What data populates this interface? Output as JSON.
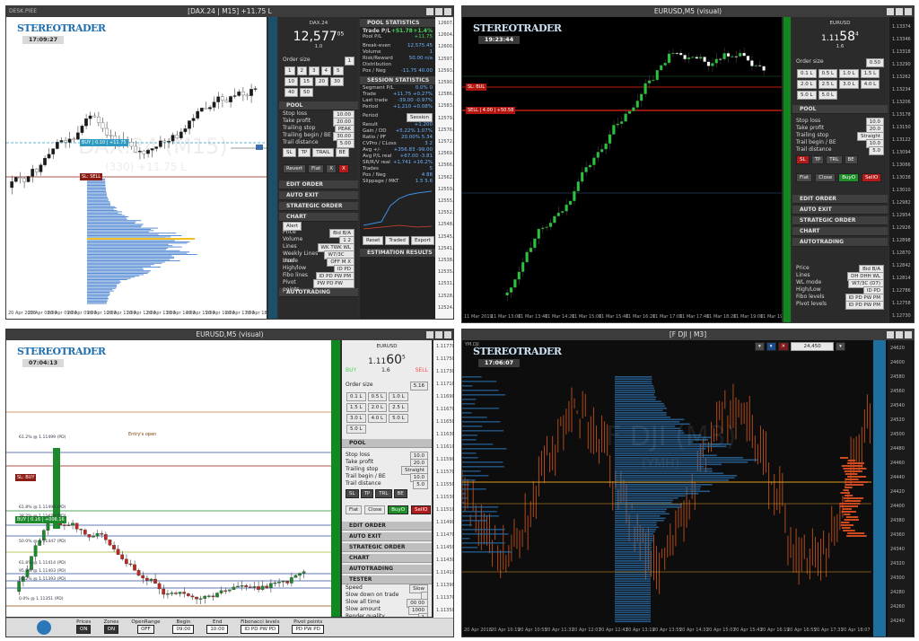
{
  "windows": {
    "w1": {
      "title": "[DAX.24 | M15] +11.75 L",
      "symbol": "DESK.PIEE",
      "brand": "STEREOTRADER",
      "clock": "17:09:27",
      "watermark": "DAX.24 (M15)",
      "watermark_sub": "(330) +11.75 L",
      "y_ticks": [
        "12607.45",
        "12604.00",
        "12600.55",
        "12597.10",
        "12593.65",
        "12590.20",
        "12586.75",
        "12583.30",
        "12579.85",
        "12576.40",
        "12572.95",
        "12569.50",
        "12566.05",
        "12562.60",
        "12559.15",
        "12555.70",
        "12552.25",
        "12548.80",
        "12545.35",
        "12541.90",
        "12538.45",
        "12535.00",
        "12531.55",
        "12528.10",
        "12524.65"
      ],
      "x_ticks": [
        "20 Apr 2018",
        "20 Apr 08:00",
        "20 Apr 09:00",
        "20 Apr 09:00",
        "20 Apr 10:00",
        "20 Apr 11:00",
        "20 Apr 12:00",
        "20 Apr 13:00",
        "20 Apr 14:00",
        "20 Apr 15:00",
        "20 Apr 16:00",
        "20 Apr 17:00",
        "20 Apr 18:00"
      ],
      "line_label_sl": "SL: SELL",
      "line_label_buy": "BUY | 0.10 | +11.75",
      "panel": {
        "symbol": "DAX.24",
        "price": "12,577",
        "price_suffix": "05",
        "spread": "1.0",
        "order_size_label": "Order size",
        "order_size": "1",
        "size_grid": [
          "1",
          "2",
          "3",
          "4",
          "5",
          "10",
          "15",
          "20",
          "30",
          "40",
          "50"
        ],
        "pool": "POOL",
        "fields": [
          {
            "label": "Stop loss",
            "value": "10.00"
          },
          {
            "label": "Take profit",
            "value": "20.00"
          },
          {
            "label": "Trailing stop",
            "value": "PEAK"
          },
          {
            "label": "Trailing begin / BE",
            "value": "30.00"
          },
          {
            "label": "Trail distance",
            "value": "5.00"
          }
        ],
        "mode_btns": [
          "SL",
          "TP",
          "TRAIL",
          "BE"
        ],
        "action_btns": [
          "Revert",
          "Flat",
          "X",
          "X"
        ],
        "action_right": [
          "BUY",
          "8"
        ],
        "sections": [
          "EDIT ORDER",
          "AUTO EXIT",
          "STRATEGIC ORDER",
          "CHART",
          "AUTOTRADING"
        ],
        "chart_rows": [
          {
            "label": "Price",
            "value": "Bid  B/A"
          },
          {
            "label": "Volume",
            "value": "1  2"
          },
          {
            "label": "Lines",
            "value": "WK  TWK  WL"
          },
          {
            "label": "Weekly Lines mode",
            "value": "W7/3C (D7)"
          },
          {
            "label": "User",
            "value": "OFF  M  X"
          },
          {
            "label": "High/low",
            "value": "ID  PD"
          },
          {
            "label": "Fibo lines",
            "value": "ID  PD  PW  PM"
          },
          {
            "label": "Pivot points",
            "value": "PW  PD  PW  PM"
          }
        ],
        "alert_label": "Alert"
      },
      "stats": {
        "pool_title": "POOL STATISTICS",
        "trade_pl": "+51.78",
        "trade_pl_pct": "+1.4%",
        "pool_pl": "+11.75",
        "rows1": [
          {
            "k": "Break-even",
            "v": "12,575.45"
          },
          {
            "k": "Volume",
            "v": "1"
          },
          {
            "k": "Risk/Reward",
            "v": "50.00  n/a"
          },
          {
            "k": "Distribution",
            "v": ""
          },
          {
            "k": "Pos / Neg",
            "v": "-11.75  40.00"
          }
        ],
        "session_title": "SESSION STATISTICS",
        "rows2": [
          {
            "k": "Segment P/L",
            "v": "0.0%  0"
          },
          {
            "k": "Trade",
            "v": "+11.75  +0.27%"
          },
          {
            "k": "Last trade",
            "v": "-39.00  -0.97%"
          },
          {
            "k": "Period",
            "v": "+1,210  +0.08%"
          }
        ],
        "period_label": "Period",
        "period_value": "Session",
        "rows3": [
          {
            "k": "Result",
            "v": "+1,200"
          },
          {
            "k": "Gain / DD",
            "v": "+5.22%  1.07%"
          },
          {
            "k": "Ratio / PF",
            "v": "20.00%  5.34"
          },
          {
            "k": "CVPro / CLoss",
            "v": "3  2"
          },
          {
            "k": "Avg +/-",
            "v": "+356.83  -99.00"
          },
          {
            "k": "Avg P/L real",
            "v": "+67.00  -3.81"
          },
          {
            "k": "SR/R/V real",
            "v": "+1,741  +16.2%"
          },
          {
            "k": "Trades",
            "v": "5"
          },
          {
            "k": "Pos / Neg",
            "v": "4  88"
          },
          {
            "k": "Slippage / MKT",
            "v": "1.5  5.6"
          }
        ],
        "btns": [
          "Reset",
          "Traded",
          "Export"
        ],
        "estimation": "ESTIMATION RESULTS"
      }
    },
    "w2": {
      "title": "EURUSD,M5 (visual)",
      "brand": "STEREOTRADER",
      "clock": "19:23:44",
      "sl_label": "SL: BUL",
      "sell_label": "SELL | 4.00 | +50.58",
      "y_ticks": [
        "1.13374",
        "1.13346",
        "1.13318",
        "1.13290",
        "1.13262",
        "1.13234",
        "1.13206",
        "1.13178",
        "1.13150",
        "1.13122",
        "1.13094",
        "1.13066",
        "1.13038",
        "1.13010",
        "1.12982",
        "1.12954",
        "1.12926",
        "1.12898",
        "1.12870",
        "1.12842",
        "1.12814",
        "1.12786",
        "1.12758",
        "1.12730"
      ],
      "x_ticks": [
        "11 Mar 2019",
        "11 Mar 13:00",
        "11 Mar 13:40",
        "11 Mar 14:20",
        "11 Mar 15:00",
        "11 Mar 15:40",
        "11 Mar 16:20",
        "11 Mar 17:00",
        "11 Mar 17:40",
        "11 Mar 18:20",
        "11 Mar 19:00",
        "11 Mar 19:40"
      ],
      "panel": {
        "symbol": "EURUSD",
        "price_main": "1.11",
        "price_big": "58",
        "price_suffix": "4",
        "spread": "1.6",
        "order_size_label": "Order size",
        "order_size": "0.50",
        "lots": [
          "0.1 L",
          "0.5 L",
          "1.0 L",
          "1.5 L",
          "2.0 L",
          "2.5 L",
          "3.0 L",
          "4.0 L",
          "5.0 L",
          "5.0 L"
        ],
        "pool": "POOL",
        "fields": [
          {
            "label": "Stop loss",
            "value": "10.0"
          },
          {
            "label": "Take profit",
            "value": "20.0"
          },
          {
            "label": "Trailing stop",
            "value": "Straight"
          },
          {
            "label": "Trail begin / BE",
            "value": "10.0"
          },
          {
            "label": "Trail distance",
            "value": "5.0"
          }
        ],
        "mode_btns": [
          "SL",
          "TP",
          "TRL",
          "BE"
        ],
        "actions": [
          "Flat",
          "Close",
          "BuyO",
          "SellO"
        ],
        "sections": [
          "EDIT ORDER",
          "AUTO EXIT",
          "STRATEGIC ORDER",
          "CHART",
          "AUTOTRADING"
        ],
        "chart_rows": [
          {
            "label": "Price",
            "value": "Bid  B/A"
          },
          {
            "label": "Lines",
            "value": "DH  DHH  WL"
          },
          {
            "label": "WL mode",
            "value": "W7/3C (D7)"
          },
          {
            "label": "High/Low",
            "value": "ID  PD"
          },
          {
            "label": "Fibo levels",
            "value": "ID  PD  PW  PM"
          },
          {
            "label": "Pivot levels",
            "value": "ID  PD  PW  PM"
          }
        ]
      }
    },
    "w3": {
      "title": "EURUSD,M5 (visual)",
      "brand": "STEREOTRADER",
      "clock": "07:04:13",
      "sl_label": "SL: BUY",
      "buy_label": "BUY | 0.16 | +006.16",
      "upper_label": "Entry's open",
      "fib_labels": [
        "61.2% @ 1.11499 (PD)",
        "61.8% @ 1.11490 (PD)",
        "38.2% @ 1.11470 (PD)",
        "50.0% @ 1.11447 (PD)",
        "61.8% @ 1.11414 (PD)",
        "95.5% @ 1.11403 (PD)",
        "38.2% @ 1.11393 (PD)",
        "0.0% @ 1.11351 (PD)"
      ],
      "y_ticks": [
        "1.11770",
        "1.11750",
        "1.11730",
        "1.11710",
        "1.11690",
        "1.11670",
        "1.11650",
        "1.11630",
        "1.11610",
        "1.11590",
        "1.11570",
        "1.11550",
        "1.11530",
        "1.11510",
        "1.11490",
        "1.11470",
        "1.11450",
        "1.11430",
        "1.11410",
        "1.11390",
        "1.11370",
        "1.11350"
      ],
      "panel": {
        "symbol": "EURUSD",
        "price_main": "1.11",
        "price_big": "60",
        "price_suffix": "5",
        "buy": "BUY",
        "spread": "1.6",
        "sell": "SELL",
        "order_size_label": "Order size",
        "order_size": "5.16",
        "lots": [
          "0.1 L",
          "0.5 L",
          "1.0 L",
          "1.5 L",
          "2.0 L",
          "2.5 L",
          "3.0 L",
          "4.0 L",
          "5.0 L",
          "5.0 L"
        ],
        "pool": "POOL",
        "fields": [
          {
            "label": "Stop loss",
            "value": "10.0"
          },
          {
            "label": "Take profit",
            "value": "20.0"
          },
          {
            "label": "Trailing stop",
            "value": "Straight"
          },
          {
            "label": "Trail begin / BE",
            "value": "10.0"
          },
          {
            "label": "Trail distance",
            "value": "5.0"
          }
        ],
        "mode_btns": [
          "SL",
          "TP",
          "TRL",
          "BE"
        ],
        "actions": [
          "Flat",
          "Close",
          "BuyO",
          "SellO"
        ],
        "sections": [
          "EDIT ORDER",
          "AUTO EXIT",
          "STRATEGIC ORDER",
          "CHART",
          "AUTOTRADING"
        ],
        "tester": "TESTER",
        "tester_rows": [
          {
            "label": "Speed",
            "value": "Slow"
          },
          {
            "label": "Slow down on trade",
            "value": ""
          },
          {
            "label": "Slow all time",
            "value": "00 00"
          },
          {
            "label": "Slow amount",
            "value": "1000"
          },
          {
            "label": "Render quality",
            "value": "1"
          }
        ]
      },
      "tester_bar": {
        "labels": [
          "Prices",
          "Zones",
          "OpenRange",
          "Begin",
          "End",
          "Fibonacci levels",
          "Pivot points"
        ],
        "values": [
          "ON",
          "ON",
          "OFF",
          "09:00",
          "10:00",
          "ID  PD  PW  PD",
          "PD  PW  PD"
        ]
      }
    },
    "w4": {
      "title": "[F DJI | M3]",
      "symbol": "YM.DJI",
      "brand": "STEREOTRADER",
      "clock": "17:06:07",
      "watermark": "F DJI (M3)",
      "watermark_sub": "(YMH)",
      "price": "24,450",
      "y_ticks": [
        "24620",
        "24600",
        "24580",
        "24560",
        "24540",
        "24520",
        "24500",
        "24480",
        "24460",
        "24440",
        "24420",
        "24400",
        "24380",
        "24360",
        "24340",
        "24320",
        "24300",
        "24280",
        "24260",
        "24240"
      ],
      "x_ticks": [
        "20 Apr 2018",
        "20 Apr 10:19",
        "20 Apr 10:55",
        "20 Apr 11:31",
        "20 Apr 12:07",
        "20 Apr 12:43",
        "20 Apr 13:19",
        "20 Apr 13:55",
        "20 Apr 14:31",
        "20 Apr 15:07",
        "20 Apr 15:43",
        "20 Apr 16:19",
        "20 Apr 16:55",
        "20 Apr 17:31",
        "20 Apr 18:07"
      ]
    }
  },
  "colors": {
    "bull": "#21a832",
    "bear": "#c0261e",
    "accent": "#1e6fb0",
    "profile": "#5b8fd6",
    "panel_dark": "#2b2b2b"
  }
}
